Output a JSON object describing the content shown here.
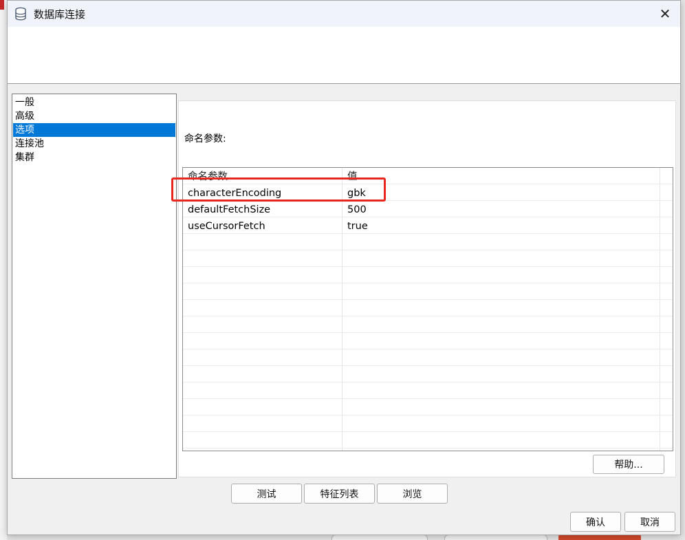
{
  "window": {
    "title": "数据库连接",
    "icon": "database-icon",
    "close_glyph": "✕"
  },
  "nav": {
    "items": [
      {
        "label": "一般",
        "selected": false
      },
      {
        "label": "高级",
        "selected": false
      },
      {
        "label": "选项",
        "selected": true
      },
      {
        "label": "连接池",
        "selected": false
      },
      {
        "label": "集群",
        "selected": false
      }
    ]
  },
  "options": {
    "section_label": "命名参数:",
    "columns": [
      "命名参数",
      "值"
    ],
    "rows": [
      {
        "name": "characterEncoding",
        "value": "gbk"
      },
      {
        "name": "defaultFetchSize",
        "value": "500"
      },
      {
        "name": "useCursorFetch",
        "value": "true"
      }
    ],
    "help_label": "帮助..."
  },
  "buttons": {
    "test": "测试",
    "feature_list": "特征列表",
    "browse": "浏览",
    "ok": "确认",
    "cancel": "取消"
  },
  "colors": {
    "selection": "#0078d7",
    "highlight": "#e8271f"
  }
}
